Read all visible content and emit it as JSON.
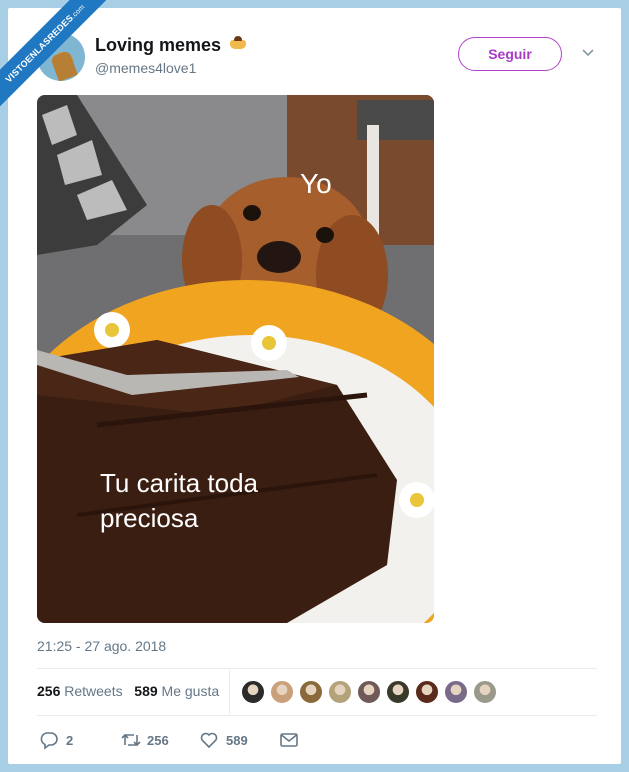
{
  "watermark": {
    "text": "VISTOENLASREDES",
    "suffix": ".com"
  },
  "tweet": {
    "display_name": "Loving memes",
    "handle": "@memes4love1",
    "follow_label": "Seguir",
    "image_captions": {
      "top": "Yo",
      "bottom": "Tu carita toda preciosa"
    },
    "timestamp": "21:25 - 27 ago. 2018",
    "retweets_count": "256",
    "retweets_label": "Retweets",
    "likes_count": "589",
    "likes_label": "Me gusta",
    "actions": {
      "replies": "2",
      "retweets": "256",
      "likes": "589"
    }
  },
  "icons": [
    "pudding-emoji",
    "chevron-down-icon",
    "reply-icon",
    "retweet-icon",
    "heart-icon",
    "mail-icon"
  ],
  "colors": {
    "follow_accent": "#a93ac2",
    "secondary_text": "#657786",
    "background": "#a9cfe6"
  },
  "liker_avatars": [
    "#2b2b2b",
    "#c9a07a",
    "#8a6a3a",
    "#b4a27a",
    "#6f5a58",
    "#3a3a2a",
    "#5a2a1a",
    "#7a6a8a",
    "#9a9a8a"
  ]
}
